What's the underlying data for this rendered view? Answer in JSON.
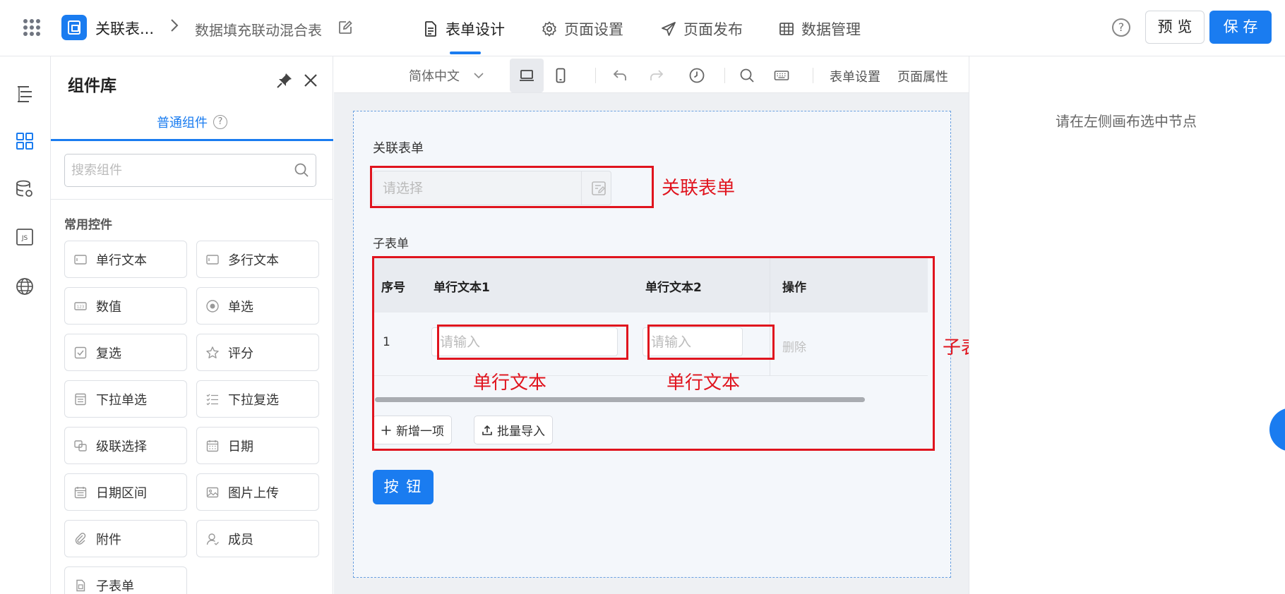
{
  "header": {
    "app_title": "关联表...",
    "breadcrumb_sep": ">",
    "page_name": "数据填充联动混合表",
    "tabs": [
      {
        "label": "表单设计",
        "icon": "document-icon",
        "active": true
      },
      {
        "label": "页面设置",
        "icon": "gear-icon",
        "active": false
      },
      {
        "label": "页面发布",
        "icon": "send-icon",
        "active": false
      },
      {
        "label": "数据管理",
        "icon": "table-grid-icon",
        "active": false
      }
    ],
    "help_glyph": "?",
    "preview_label": "预 览",
    "save_label": "保 存"
  },
  "rail": {
    "items": [
      "outline-tree-icon",
      "components-grid-icon",
      "database-icon",
      "js-icon",
      "globe-icon"
    ]
  },
  "library": {
    "title": "组件库",
    "tab_label": "普通组件",
    "tab_help": "?",
    "search_placeholder": "搜索组件",
    "section_title": "常用控件",
    "components": [
      {
        "label": "单行文本",
        "icon": "single-line-text-icon"
      },
      {
        "label": "多行文本",
        "icon": "multi-line-text-icon"
      },
      {
        "label": "数值",
        "icon": "number-icon"
      },
      {
        "label": "单选",
        "icon": "radio-icon"
      },
      {
        "label": "复选",
        "icon": "checkbox-icon"
      },
      {
        "label": "评分",
        "icon": "star-icon"
      },
      {
        "label": "下拉单选",
        "icon": "dropdown-single-icon"
      },
      {
        "label": "下拉复选",
        "icon": "dropdown-multi-icon"
      },
      {
        "label": "级联选择",
        "icon": "cascade-icon"
      },
      {
        "label": "日期",
        "icon": "calendar-icon"
      },
      {
        "label": "日期区间",
        "icon": "date-range-icon"
      },
      {
        "label": "图片上传",
        "icon": "image-upload-icon"
      },
      {
        "label": "附件",
        "icon": "attachment-icon"
      },
      {
        "label": "成员",
        "icon": "member-icon"
      },
      {
        "label": "子表单",
        "icon": "subform-icon"
      }
    ]
  },
  "toolbar": {
    "language": "简体中文",
    "form_settings": "表单设置",
    "page_props": "页面属性"
  },
  "form": {
    "relation_label": "关联表单",
    "relation_placeholder": "请选择",
    "subform_label": "子表单",
    "subform": {
      "headers": [
        "序号",
        "单行文本1",
        "单行文本2",
        "操作"
      ],
      "rows": [
        {
          "index": "1",
          "input1_placeholder": "请输入",
          "input2_placeholder": "请输入",
          "action": "删除"
        }
      ],
      "add_button": "新增一项",
      "import_button": "批量导入"
    },
    "button_label": "按 钮"
  },
  "annotations": {
    "relation": "关联表单",
    "subform": "子表单",
    "text1": "单行文本",
    "text2": "单行文本",
    "color": "#e0141e"
  },
  "right_panel": {
    "hint": "请在左侧画布选中节点"
  },
  "colors": {
    "accent": "#1a7cf0",
    "annotation": "#e0141e"
  }
}
